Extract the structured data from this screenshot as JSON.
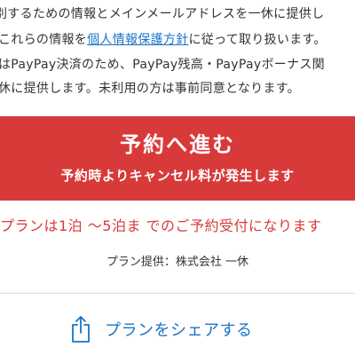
{
  "notice": {
    "line1": "別するための情報とメインメールアドレスを一休に提供し",
    "line2_prefix": "これらの情報を",
    "line2_link": "個人情報保護方針",
    "line2_suffix": "に従って取り扱います。",
    "line3": "はPayPay決済のため、PayPay残高・PayPayボーナス関",
    "line4": "休に提供します。未利用の方は事前同意となります。"
  },
  "reserve_button": {
    "main_label": "予約へ進む",
    "sub_label": "予約時よりキャンセル料が発生します"
  },
  "plan_range": "プランは1泊 〜5泊ま でのご予約受付になります",
  "provider": "プラン提供：株式会社 一休",
  "share": {
    "label": "プランをシェアする",
    "icon": "share-icon"
  },
  "colors": {
    "accent_red": "#d83a3a",
    "link_blue": "#1a73c9",
    "text": "#333333"
  }
}
